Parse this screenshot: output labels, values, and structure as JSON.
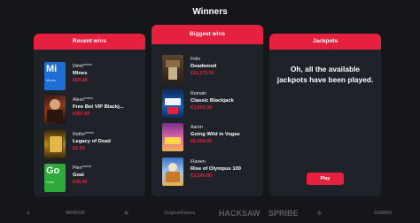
{
  "page": {
    "title": "Winners"
  },
  "recent": {
    "header": "Recent wins",
    "items": [
      {
        "name": "Dimit*****",
        "game": "Mines",
        "amount": "€69.28",
        "icon": "mines-thumbnail",
        "thumb_text": "Mi",
        "thumb_sub": "Mines"
      },
      {
        "name": "Alexs*****",
        "game": "Free Bet VIP Blackj...",
        "amount": "€687.50",
        "icon": "blackjack-thumbnail"
      },
      {
        "name": "Rathe*****",
        "game": "Legacy of Dead",
        "amount": "€3.00",
        "icon": "legacy-of-dead-thumbnail"
      },
      {
        "name": "Pierr*****",
        "game": "Goal",
        "amount": "€45.46",
        "icon": "goal-thumbnail",
        "thumb_text": "Go",
        "thumb_sub": "Goal"
      }
    ]
  },
  "biggest": {
    "header": "Biggest wins",
    "items": [
      {
        "name": "Felix",
        "game": "Deadwood",
        "amount": "€11,275.50",
        "icon": "deadwood-thumbnail"
      },
      {
        "name": "Romain",
        "game": "Classic Blackjack",
        "amount": "€3,000.00",
        "icon": "classic-blackjack-thumbnail"
      },
      {
        "name": "Aaron",
        "game": "Going Wild in Vegas",
        "amount": "€6,608.80",
        "icon": "going-wild-in-vegas-thumbnail"
      },
      {
        "name": "Flavien",
        "game": "Rise of Olympus 100",
        "amount": "€3,249.80",
        "icon": "rise-of-olympus-thumbnail"
      }
    ]
  },
  "jackpots": {
    "header": "Jackpots",
    "message": "Oh, all the available jackpots have been played.",
    "play_label": "Play"
  },
  "providers": [
    {
      "label": "MERKUR"
    },
    {
      "label": "OriginalGames"
    },
    {
      "label": "HACKSAW"
    },
    {
      "label": "SPRIBE"
    },
    {
      "label": "GAMING"
    }
  ],
  "colors": {
    "accent": "#e5213f",
    "background": "#14161a",
    "card": "#1f2228"
  }
}
